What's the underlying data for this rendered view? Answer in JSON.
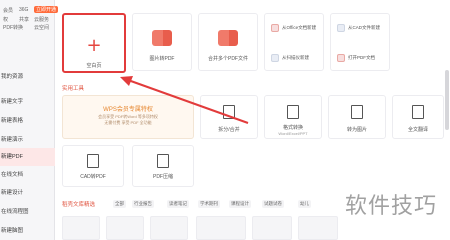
{
  "sidebar": {
    "top": {
      "member_label": "会员",
      "size_label": "36G",
      "badge": "立即开通",
      "line2a": "权",
      "line2b": "共享",
      "line2c": "云服务",
      "line3a": "PDF转换",
      "line3b": "云空间"
    },
    "items": [
      {
        "label": "我的资源"
      },
      {
        "label": "新建文字"
      },
      {
        "label": "新建表格"
      },
      {
        "label": "新建演示"
      },
      {
        "label": "新建PDF"
      },
      {
        "label": "在线文档"
      },
      {
        "label": "新建设计"
      },
      {
        "label": "在线流程图"
      },
      {
        "label": "新建脑图"
      }
    ]
  },
  "tiles": {
    "blank": "空白页",
    "image_to_pdf": "图片转PDF",
    "merge_pdf": "合并多个PDF文件",
    "from_office": "从Office文档新建",
    "from_scanner": "从扫描仪新建",
    "from_cad": "从CAD文件新建",
    "open_pdf": "打开PDF文档"
  },
  "tools_section": {
    "title": "实用工具",
    "wps": {
      "title": "WPS会员专属特权",
      "sub1": "会员享受 PDF转Word 等多项特权",
      "sub2": "无需付费 享受 PDF 全功能"
    },
    "tools": [
      {
        "label": "拆分/合并",
        "sub": ""
      },
      {
        "label": "格式转换",
        "sub": "Word/Excel/PPT"
      },
      {
        "label": "转为图片",
        "sub": ""
      },
      {
        "label": "全文翻译",
        "sub": ""
      },
      {
        "label": "CAD转PDF",
        "sub": ""
      },
      {
        "label": "PDF压缩",
        "sub": ""
      }
    ]
  },
  "templates": {
    "title": "稻壳文库精选",
    "chips": [
      "全部",
      "行业报告",
      "读者笔记",
      "学术期刊",
      "课程设计",
      "试题试卷",
      "幼儿"
    ]
  },
  "watermark": "软件技巧",
  "colors": {
    "accent": "#e5463f",
    "highlight_border": "#e23b3b",
    "wps_orange": "#e6862f"
  }
}
